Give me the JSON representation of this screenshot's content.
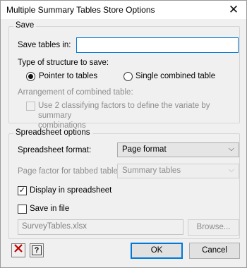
{
  "window": {
    "title": "Multiple Summary Tables Store Options",
    "close_glyph": "✕"
  },
  "save_group": {
    "legend": "Save",
    "save_tables_in_label": "Save tables in:",
    "save_tables_in_value": "",
    "structure_type_label": "Type of structure to save:",
    "radio_pointer": {
      "label": "Pointer to tables",
      "checked": true
    },
    "radio_single": {
      "label": "Single combined table",
      "checked": false
    },
    "arrangement_label": "Arrangement of combined table:",
    "use_two_factors": {
      "label_line1": "Use 2 classifying factors to define the variate by summary",
      "label_line2": "combinations",
      "checked": false
    }
  },
  "spreadsheet_group": {
    "legend": "Spreadsheet options",
    "format_label": "Spreadsheet format:",
    "format_value": "Page format",
    "page_factor_label": "Page factor for tabbed table:",
    "page_factor_value": "Summary tables",
    "display_in_spreadsheet": {
      "label": "Display in spreadsheet",
      "checked": true
    },
    "save_in_file": {
      "label": "Save in file",
      "checked": false
    },
    "file_name": "SurveyTables.xlsx",
    "browse_label": "Browse..."
  },
  "footer": {
    "clear_icon": "x-icon",
    "help_icon": "help-icon",
    "clear_color": "#c00000",
    "help_glyph": "?",
    "ok_label": "OK",
    "cancel_label": "Cancel"
  }
}
